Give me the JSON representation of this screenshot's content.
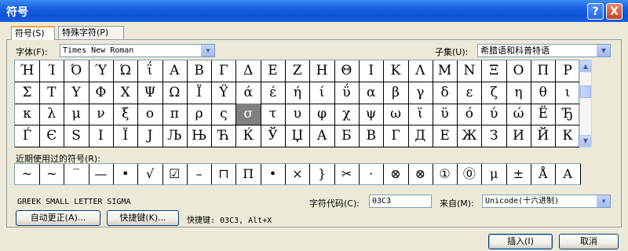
{
  "window": {
    "title": "符号",
    "help_label": "?",
    "close_label": "X"
  },
  "tabs": [
    {
      "label": "符号(S)"
    },
    {
      "label": "特殊字符(P)"
    }
  ],
  "font": {
    "label": "字体(F):",
    "value": "Times New Roman"
  },
  "subset": {
    "label": "子集(U):",
    "value": "希腊语和科普特语"
  },
  "symbols": [
    [
      "Ή",
      "Ί",
      "Ό",
      "Ύ",
      "Ώ",
      "ΐ",
      "Α",
      "Β",
      "Γ",
      "Δ",
      "Ε",
      "Ζ",
      "Η",
      "Θ",
      "Ι",
      "Κ",
      "Λ",
      "Μ",
      "Ν",
      "Ξ",
      "Ο",
      "Π",
      "Ρ"
    ],
    [
      "Σ",
      "Τ",
      "Υ",
      "Φ",
      "Χ",
      "Ψ",
      "Ω",
      "Ϊ",
      "Ϋ",
      "ά",
      "έ",
      "ή",
      "ί",
      "ΰ",
      "α",
      "β",
      "γ",
      "δ",
      "ε",
      "ζ",
      "η",
      "θ",
      "ι"
    ],
    [
      "κ",
      "λ",
      "μ",
      "ν",
      "ξ",
      "ο",
      "π",
      "ρ",
      "ς",
      "σ",
      "τ",
      "υ",
      "φ",
      "χ",
      "ψ",
      "ω",
      "ϊ",
      "ϋ",
      "ό",
      "ύ",
      "ώ",
      "Ё",
      "Ђ"
    ],
    [
      "Ѓ",
      "Є",
      "Ѕ",
      "І",
      "Ї",
      "Ј",
      "Љ",
      "Њ",
      "Ћ",
      "Ќ",
      "Ў",
      "Џ",
      "А",
      "Б",
      "В",
      "Г",
      "Д",
      "Е",
      "Ж",
      "З",
      "И",
      "Й",
      "К"
    ]
  ],
  "selected_symbol": "σ",
  "recent": {
    "label": "近期使用过的符号(R):",
    "items": [
      "~",
      "~",
      "‾",
      "—",
      "•",
      "√",
      "☑",
      "–",
      "⊓",
      "Π",
      "•",
      "×",
      "}",
      "✂",
      "·",
      "⊗",
      "⊗",
      "①",
      "⓪",
      "μ",
      "±",
      "Å",
      "A"
    ]
  },
  "char_name": "GREEK SMALL LETTER SIGMA",
  "char_code": {
    "label": "字符代码(C):",
    "value": "03C3"
  },
  "from": {
    "label": "来自(M):",
    "value": "Unicode(十六进制)"
  },
  "buttons": {
    "autocorrect": "自动更正(A)...",
    "shortcut_key": "快捷键(K)...",
    "shortcut_text": "快捷键: 03C3, Alt+X",
    "insert": "插入(I)",
    "cancel": "取消"
  }
}
